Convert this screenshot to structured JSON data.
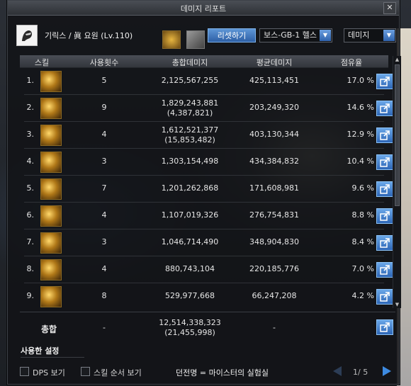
{
  "window": {
    "title": "데미지 리포트",
    "close_label": "✕"
  },
  "header": {
    "character": "기릭스 / 眞 요원 (Lv.110)",
    "reset_label": "리셋하기",
    "dropdown1": "보스-GB-1 헬스",
    "dropdown2": "데미지"
  },
  "table": {
    "columns": [
      "스킬",
      "사용횟수",
      "총합데미지",
      "평균데미지",
      "점유율"
    ],
    "rows": [
      {
        "rank": "1.",
        "icon": "skill-icon-1",
        "uses": "5",
        "total": "2,125,567,255",
        "total_sub": "",
        "avg": "425,113,451",
        "share": "17.0 %"
      },
      {
        "rank": "2.",
        "icon": "skill-icon-2",
        "uses": "9",
        "total": "1,829,243,881",
        "total_sub": "(4,387,821)",
        "avg": "203,249,320",
        "share": "14.6 %"
      },
      {
        "rank": "3.",
        "icon": "skill-icon-3",
        "uses": "4",
        "total": "1,612,521,377",
        "total_sub": "(15,853,482)",
        "avg": "403,130,344",
        "share": "12.9 %"
      },
      {
        "rank": "4.",
        "icon": "skill-icon-4",
        "uses": "3",
        "total": "1,303,154,498",
        "total_sub": "",
        "avg": "434,384,832",
        "share": "10.4 %"
      },
      {
        "rank": "5.",
        "icon": "skill-icon-5",
        "uses": "7",
        "total": "1,201,262,868",
        "total_sub": "",
        "avg": "171,608,981",
        "share": "9.6 %"
      },
      {
        "rank": "6.",
        "icon": "skill-icon-6",
        "uses": "4",
        "total": "1,107,019,326",
        "total_sub": "",
        "avg": "276,754,831",
        "share": "8.8 %"
      },
      {
        "rank": "7.",
        "icon": "skill-icon-7",
        "uses": "3",
        "total": "1,046,714,490",
        "total_sub": "",
        "avg": "348,904,830",
        "share": "8.4 %"
      },
      {
        "rank": "8.",
        "icon": "skill-icon-8",
        "uses": "4",
        "total": "880,743,104",
        "total_sub": "",
        "avg": "220,185,776",
        "share": "7.0 %"
      },
      {
        "rank": "9.",
        "icon": "skill-icon-9",
        "uses": "8",
        "total": "529,977,668",
        "total_sub": "",
        "avg": "66,247,208",
        "share": "4.2 %"
      }
    ]
  },
  "total": {
    "label": "총합",
    "uses": "-",
    "total": "12,514,338,323",
    "total_sub": "(21,455,998)",
    "avg": "-"
  },
  "footer": {
    "used_settings": "사용한 설정",
    "dps_label": "DPS 보기",
    "skill_order_label": "스킬 순서 보기",
    "dungeon": "던전명 = 마이스터의 실험실",
    "page": "1/ 5"
  }
}
